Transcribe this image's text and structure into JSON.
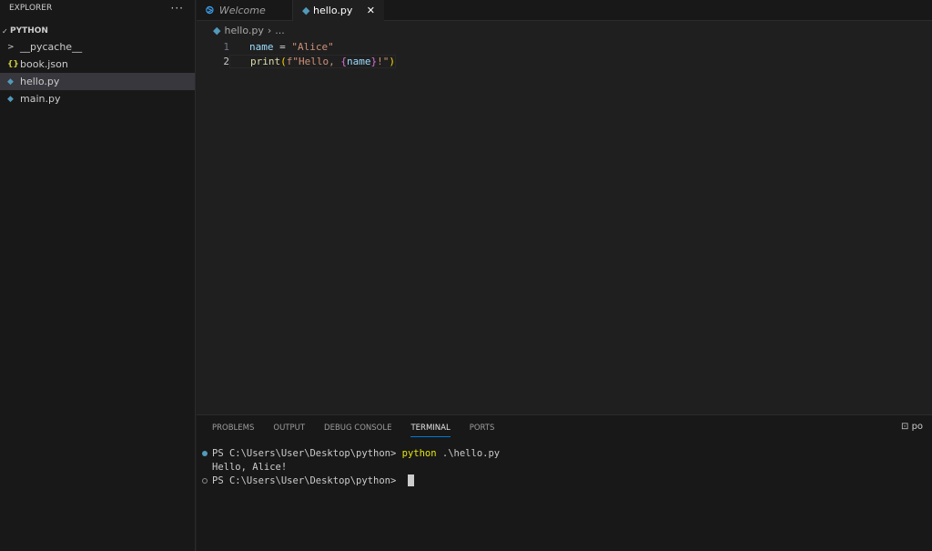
{
  "sidebar": {
    "title": "EXPLORER",
    "more": "···",
    "folder": "PYTHON",
    "items": [
      {
        "label": "__pycache__",
        "icon": "chevron-right"
      },
      {
        "label": "book.json",
        "icon": "json-braces"
      },
      {
        "label": "hello.py",
        "icon": "python"
      },
      {
        "label": "main.py",
        "icon": "python"
      }
    ]
  },
  "tabs": [
    {
      "label": "Welcome"
    },
    {
      "label": "hello.py"
    }
  ],
  "breadcrumb": {
    "file": "hello.py",
    "rest": "..."
  },
  "editor": {
    "lines": [
      {
        "n": "1",
        "tokens": [
          "name",
          " = ",
          "\"Alice\""
        ]
      },
      {
        "n": "2",
        "tokens": [
          "print",
          "(",
          "f\"Hello, ",
          "{",
          "name",
          "}",
          "!\"",
          ")"
        ]
      }
    ]
  },
  "panel": {
    "tabs": [
      "PROBLEMS",
      "OUTPUT",
      "DEBUG CONSOLE",
      "TERMINAL",
      "PORTS"
    ],
    "shell": "powershell",
    "terminal": {
      "prompt": "PS C:\\Users\\User\\Desktop\\python> ",
      "cmd": "python",
      "args": " .\\hello.py",
      "output": "Hello, Alice!"
    }
  }
}
